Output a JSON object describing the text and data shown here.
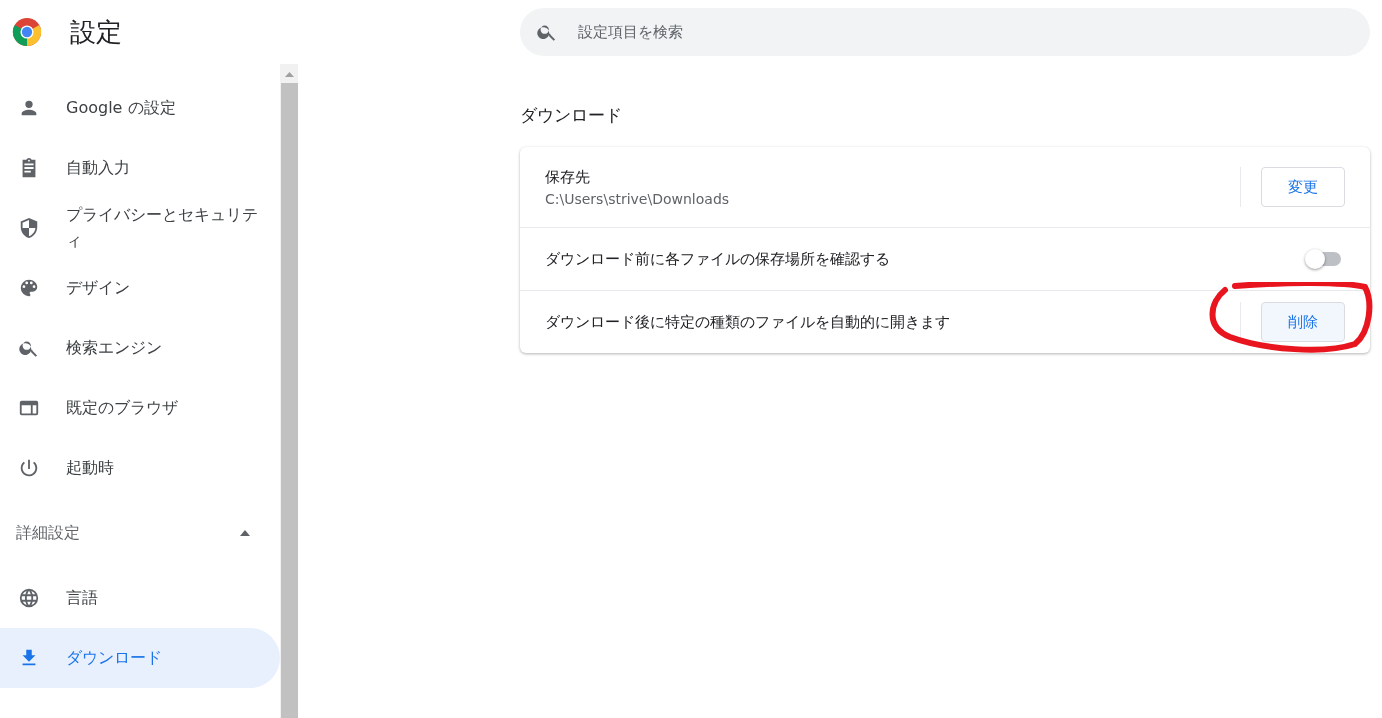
{
  "header": {
    "title": "設定"
  },
  "search": {
    "placeholder": "設定項目を検索"
  },
  "sidebar": {
    "items": [
      {
        "label": "Google の設定",
        "selected": false
      },
      {
        "label": "自動入力",
        "selected": false
      },
      {
        "label": "プライバシーとセキュリティ",
        "selected": false
      },
      {
        "label": "デザイン",
        "selected": false
      },
      {
        "label": "検索エンジン",
        "selected": false
      },
      {
        "label": "既定のブラウザ",
        "selected": false
      },
      {
        "label": "起動時",
        "selected": false
      }
    ],
    "advanced": {
      "label": "詳細設定",
      "expanded": true,
      "items": [
        {
          "label": "言語",
          "selected": false
        },
        {
          "label": "ダウンロード",
          "selected": true
        }
      ]
    }
  },
  "section": {
    "title": "ダウンロード",
    "rows": [
      {
        "kind": "button",
        "label": "保存先",
        "value": "C:\\Users\\strive\\Downloads",
        "button": "変更",
        "highlighted": false
      },
      {
        "kind": "toggle",
        "label": "ダウンロード前に各ファイルの保存場所を確認する",
        "on": false
      },
      {
        "kind": "button",
        "label": "ダウンロード後に特定の種類のファイルを自動的に開きます",
        "button": "削除",
        "highlighted": true,
        "circled": true
      }
    ]
  }
}
